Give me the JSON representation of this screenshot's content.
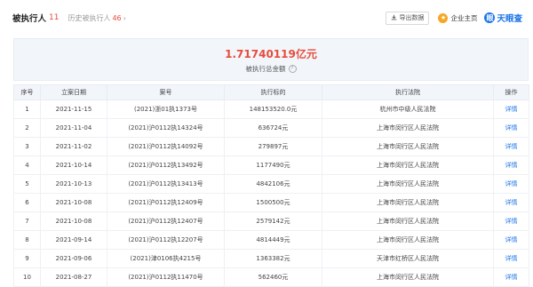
{
  "header": {
    "title": "被执行人",
    "title_count": "11",
    "history_label": "历史被执行人",
    "history_count": "46",
    "history_arrow": "›",
    "export_label": "导出数据",
    "brand_label": "企业主页",
    "brand_glyph": "★",
    "logo_text": "天眼查",
    "logo_glyph": "眼"
  },
  "summary": {
    "total": "1.71740119亿元",
    "label": "被执行总金额"
  },
  "table": {
    "columns": [
      "序号",
      "立案日期",
      "案号",
      "执行标的",
      "执行法院",
      "操作"
    ],
    "rows": [
      {
        "no": "1",
        "date": "2021-11-15",
        "case": "(2021)浙01执1373号",
        "amount": "148153520.0元",
        "court": "杭州市中级人民法院",
        "action": "详情"
      },
      {
        "no": "2",
        "date": "2021-11-04",
        "case": "(2021)沪0112执14324号",
        "amount": "636724元",
        "court": "上海市闵行区人民法院",
        "action": "详情"
      },
      {
        "no": "3",
        "date": "2021-11-02",
        "case": "(2021)沪0112执14092号",
        "amount": "279897元",
        "court": "上海市闵行区人民法院",
        "action": "详情"
      },
      {
        "no": "4",
        "date": "2021-10-14",
        "case": "(2021)沪0112执13492号",
        "amount": "1177490元",
        "court": "上海市闵行区人民法院",
        "action": "详情"
      },
      {
        "no": "5",
        "date": "2021-10-13",
        "case": "(2021)沪0112执13413号",
        "amount": "4842106元",
        "court": "上海市闵行区人民法院",
        "action": "详情"
      },
      {
        "no": "6",
        "date": "2021-10-08",
        "case": "(2021)沪0112执12409号",
        "amount": "1500500元",
        "court": "上海市闵行区人民法院",
        "action": "详情"
      },
      {
        "no": "7",
        "date": "2021-10-08",
        "case": "(2021)沪0112执12407号",
        "amount": "2579142元",
        "court": "上海市闵行区人民法院",
        "action": "详情"
      },
      {
        "no": "8",
        "date": "2021-09-14",
        "case": "(2021)沪0112执12207号",
        "amount": "4814449元",
        "court": "上海市闵行区人民法院",
        "action": "详情"
      },
      {
        "no": "9",
        "date": "2021-09-06",
        "case": "(2021)津0106执4215号",
        "amount": "1363382元",
        "court": "天津市红桥区人民法院",
        "action": "详情"
      },
      {
        "no": "10",
        "date": "2021-08-27",
        "case": "(2021)沪0112执11470号",
        "amount": "562460元",
        "court": "上海市闵行区人民法院",
        "action": "详情"
      }
    ]
  }
}
